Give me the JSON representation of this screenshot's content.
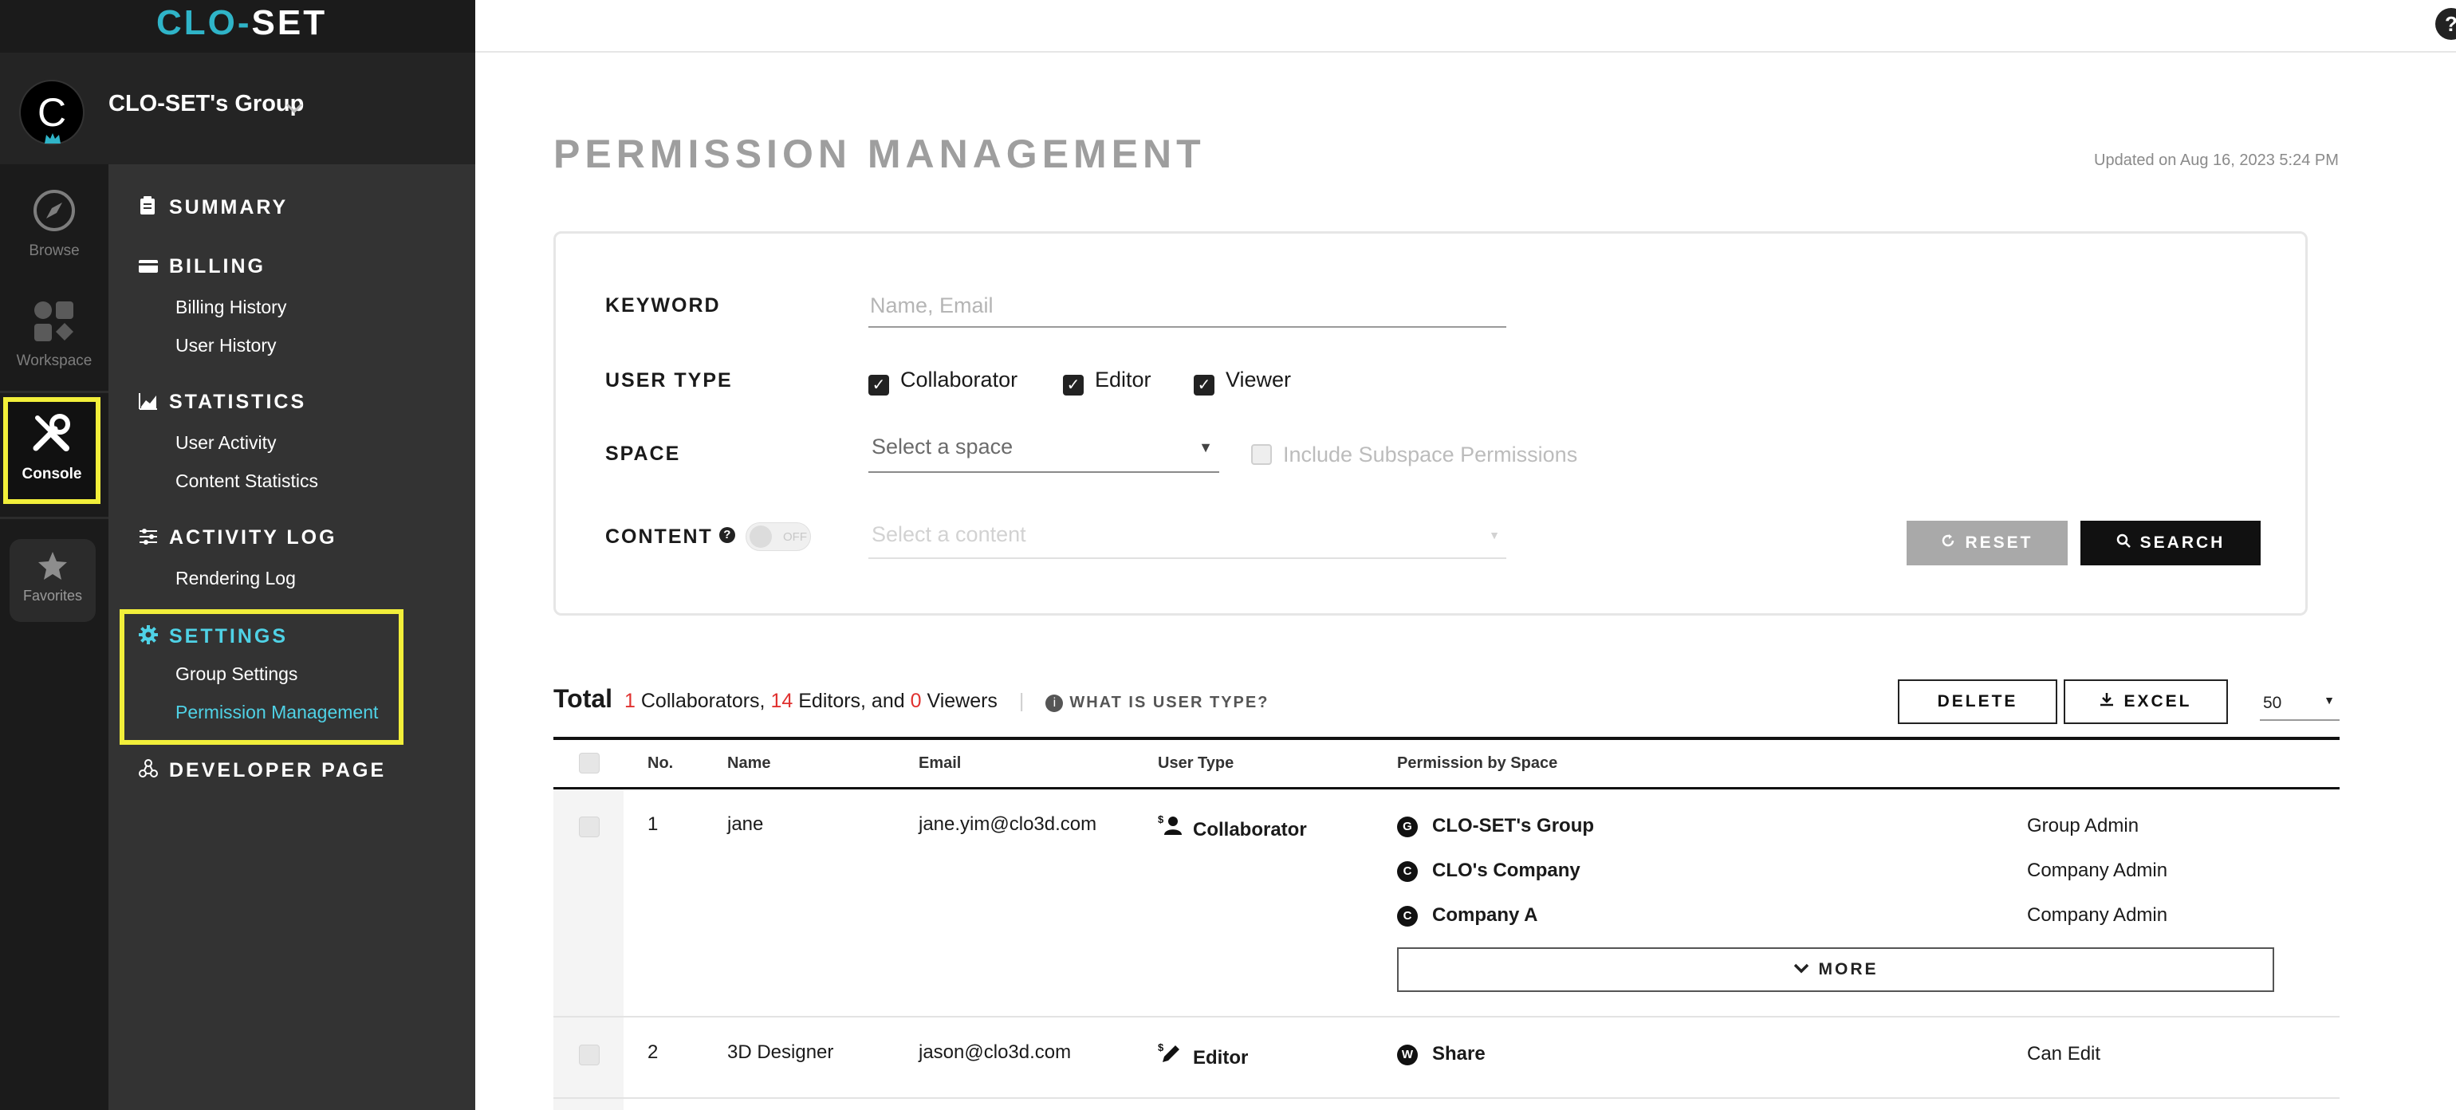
{
  "logo": {
    "c": "CL",
    "o": "O",
    "dash": "-",
    "set": "SET"
  },
  "help_icon": "?",
  "group": {
    "avatar_letter": "C",
    "name": "CLO-SET's Group",
    "chevron": "⌄"
  },
  "rail": {
    "browse": "Browse",
    "workspace": "Workspace",
    "console": "Console",
    "favorites": "Favorites"
  },
  "menu": {
    "summary": "SUMMARY",
    "billing": "BILLING",
    "billing_history": "Billing History",
    "user_history": "User History",
    "statistics": "STATISTICS",
    "user_activity": "User Activity",
    "content_statistics": "Content Statistics",
    "activity_log": "ACTIVITY LOG",
    "rendering_log": "Rendering Log",
    "settings": "SETTINGS",
    "group_settings": "Group Settings",
    "permission_management": "Permission Management",
    "developer_page": "DEVELOPER PAGE"
  },
  "page": {
    "title": "PERMISSION MANAGEMENT",
    "updated": "Updated on Aug 16, 2023 5:24 PM"
  },
  "filters": {
    "keyword_label": "KEYWORD",
    "keyword_placeholder": "Name, Email",
    "user_type_label": "USER TYPE",
    "collaborator": "Collaborator",
    "editor": "Editor",
    "viewer": "Viewer",
    "space_label": "SPACE",
    "space_placeholder": "Select a space",
    "include_subspace": "Include Subspace Permissions",
    "content_label": "CONTENT",
    "content_help": "?",
    "toggle_off": "OFF",
    "content_placeholder": "Select a content",
    "reset": "RESET",
    "search": "SEARCH",
    "check_mark": "✓"
  },
  "totals": {
    "total": "Total",
    "collaborators_count": "1",
    "collaborators_text": "Collaborators,",
    "editors_count": "14",
    "editors_text": "Editors, and",
    "viewers_count": "0",
    "viewers_text": "Viewers",
    "pipe": "|",
    "info": "i",
    "what_is": "WHAT IS USER TYPE?",
    "delete": "DELETE",
    "excel": "EXCEL",
    "per_page": "50"
  },
  "table": {
    "headers": {
      "no": "No.",
      "name": "Name",
      "email": "Email",
      "user_type": "User Type",
      "permission": "Permission by Space"
    },
    "rows": [
      {
        "no": "1",
        "name": "jane",
        "email": "jane.yim@clo3d.com",
        "user_type": "Collaborator",
        "perms": [
          {
            "badge": "G",
            "space": "CLO-SET's Group",
            "role": "Group Admin"
          },
          {
            "badge": "C",
            "space": "CLO's Company",
            "role": "Company Admin"
          },
          {
            "badge": "C",
            "space": "Company A",
            "role": "Company Admin"
          }
        ],
        "more": "MORE"
      },
      {
        "no": "2",
        "name": "3D Designer",
        "email": "jason@clo3d.com",
        "user_type": "Editor",
        "perms": [
          {
            "badge": "W",
            "space": "Share",
            "role": "Can Edit"
          }
        ]
      }
    ]
  },
  "colors": {
    "accent": "#4fd2e6",
    "highlight": "#f2ef3a",
    "count_red": "#e0312f"
  }
}
